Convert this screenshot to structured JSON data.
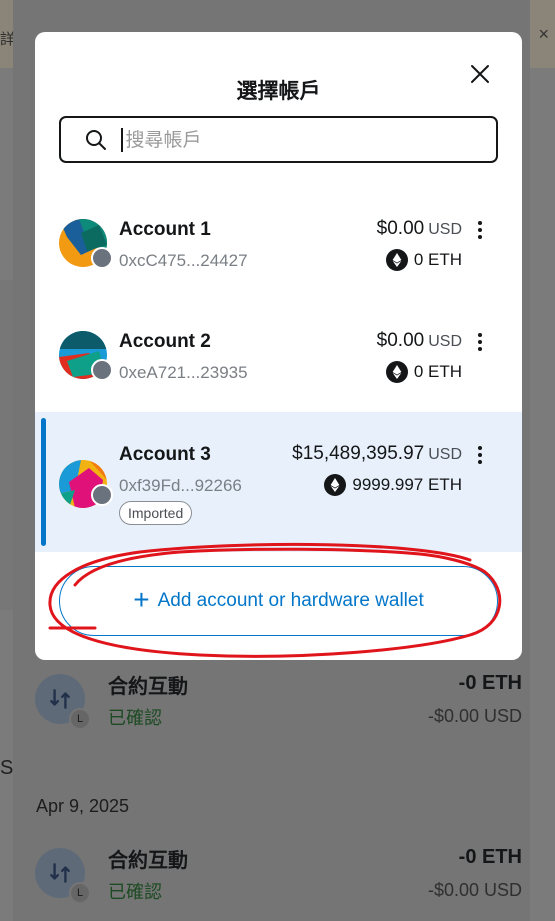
{
  "browser": {
    "partial_tab_text": "詳",
    "close_glyph": "×"
  },
  "modal": {
    "title": "選擇帳戶",
    "search_placeholder": "搜尋帳戶",
    "accounts": [
      {
        "name": "Account 1",
        "address": "0xcC475...24427",
        "fiat": "$0.00",
        "fiat_currency": "USD",
        "eth": "0 ETH",
        "tag": "",
        "selected": false
      },
      {
        "name": "Account 2",
        "address": "0xeA721...23935",
        "fiat": "$0.00",
        "fiat_currency": "USD",
        "eth": "0 ETH",
        "tag": "",
        "selected": false
      },
      {
        "name": "Account 3",
        "address": "0xf39Fd...92266",
        "fiat": "$15,489,395.97",
        "fiat_currency": "USD",
        "eth": "9999.997 ETH",
        "tag": "Imported",
        "selected": true
      }
    ],
    "add_button_label": "Add account or hardware wallet"
  },
  "background": {
    "activities": [
      {
        "title": "合約互動",
        "status": "已確認",
        "amount": "-0 ETH",
        "fiat": "-$0.00 USD",
        "badge": "L"
      },
      {
        "title": "合約互動",
        "status": "已確認",
        "amount": "-0 ETH",
        "fiat": "-$0.00 USD",
        "badge": "L"
      }
    ],
    "date_label": "Apr 9, 2025",
    "side_letter": "S"
  },
  "colors": {
    "accent": "#0376c9",
    "annotation": "#e0141b",
    "selected_bg": "#e8f1fb",
    "success": "#1c4a22"
  },
  "icons": [
    "search-icon",
    "close-icon",
    "ethereum-icon",
    "more-vertical-icon",
    "plus-icon",
    "swap-icon"
  ]
}
